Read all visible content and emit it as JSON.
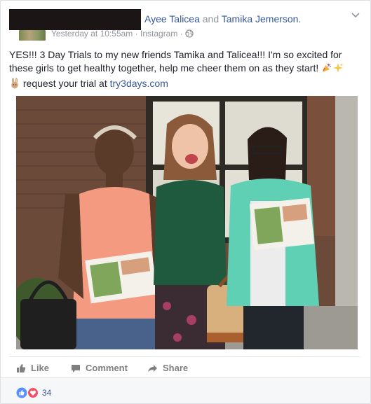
{
  "post": {
    "author_redacted": true,
    "tagged": {
      "name1": "Ayee Talicea",
      "connector": "and",
      "name2": "Tamika Jemerson."
    },
    "timestamp": "Yesterday at 10:55am",
    "separator": "·",
    "source": "Instagram",
    "source_separator": "·",
    "privacy_icon": "globe-icon",
    "text_line1": "YES!!! 3 Day Trials to my new friends Tamika and Talicea!!! I'm so excited for these girls to get healthy together, help me cheer them on as they start!",
    "text_line2": "request your trial at",
    "link": "try3days.com",
    "emoji1": "party-popper-icon",
    "emoji2": "sparkles-icon",
    "emoji3": "rabbit-icon"
  },
  "photo": {
    "description_icon": "photo-three-women-holding-brochures"
  },
  "actions": {
    "like_label": "Like",
    "comment_label": "Comment",
    "share_label": "Share"
  },
  "reactions": {
    "count": "34",
    "icons": [
      "like-reaction-icon",
      "love-reaction-icon"
    ]
  },
  "colors": {
    "link": "#365899",
    "meta": "#90949c",
    "text": "#1d2129",
    "like_blue": "#5890ff",
    "love_red": "#f25268"
  }
}
